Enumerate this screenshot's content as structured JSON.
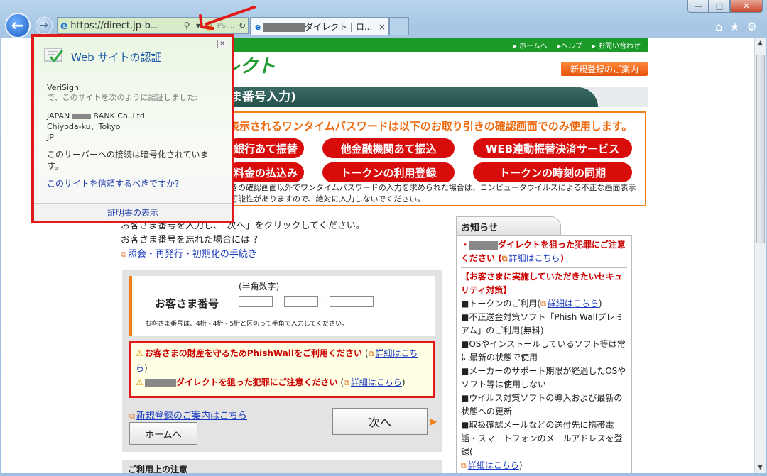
{
  "window": {
    "minimize": "—",
    "maximize": "□",
    "close": "✕"
  },
  "nav": {
    "back_icon": "←",
    "forward_icon": "→"
  },
  "address_bar": {
    "url": "https://direct.jp-b...",
    "search_icon": "⚲",
    "lock_icon": "🔒",
    "refresh_icon": "↻",
    "tint": "#d7ebc9"
  },
  "tabs": [
    {
      "title": "ダイレクト | ロ...",
      "close": "×"
    }
  ],
  "toolbar": {
    "home_icon": "⌂",
    "favorites_icon": "★",
    "settings_icon": "⚙"
  },
  "page": {
    "top_links": [
      "▸ ホームへ",
      "▸ヘルプ",
      "▸ お問い合わせ"
    ],
    "logo_text": "レクト",
    "register_button": "新規登録のご案内",
    "heading": "ま番号入力)",
    "otp": {
      "title": "表示されるワンタイムパスワードは以下のお取り引きの確認画面でのみ使用します。",
      "pills": [
        "銀行あて振替",
        "他金融機関あて振込",
        "WEB連動振替決済サービス",
        "料金の払込み",
        "トークンの利用登録",
        "トークンの時刻の同期"
      ],
      "note1": "きの確認画面以外でワンタイムパスワードの入力を求められた場合は、コンピュータウイルスによる不正な画面表示",
      "note2": "可能性がありますので、絶対に入力しないでください。"
    },
    "instructions": {
      "line1": "お客さま番号を入力し、「次へ」をクリックしてください。",
      "line2": "お客さま番号を忘れた場合には ?",
      "link": "照会・再発行・初期化の手続き"
    },
    "form": {
      "hint": "(半角数字)",
      "label": "お客さま番号",
      "dash": "-",
      "small_note": "お客さま番号は、4桁 - 4桁 - 5桁と区切って半角で入力してください。"
    },
    "warnings": {
      "w1": "お客さまの財産を守るためPhishWallをご利用ください",
      "w1_link": "詳細はこちら",
      "w2": "ダイレクトを狙った犯罪にご注意ください",
      "w2_link": "詳細はこちら"
    },
    "new_reg_link": "新規登録のご案内はこちら",
    "home_button": "ホームへ",
    "next_button": "次へ",
    "bottom_notice": "ご利用上の注意"
  },
  "news": {
    "tab": "お知らせ",
    "item1": "ダイレクトを狙った犯罪にご注意ください",
    "item1_link": "詳細はこちら",
    "section_title": "【お客さまに実施していただきたいセキュリティ対策】",
    "items": [
      "■トークンのご利用(",
      "■不正送金対策ソフト「Phish Wallプレミアム」のご利用(無料)",
      "■OSやインストールしているソフト等は常に最新の状態で使用",
      "■メーカーのサポート期限が経過したOSやソフト等は使用しない",
      "■ウイルス対策ソフトの導入および最新の状態への更新",
      "■取扱確認メールなどの送付先に携帯電話・スマートフォンのメールアドレスを登録("
    ],
    "link": "詳細はこちら"
  },
  "popup": {
    "title": "Web サイトの認証",
    "issuer": "VeriSign",
    "issuer_desc": "で、このサイトを次のように認証しました:",
    "org_line1_a": "JAPAN",
    "org_line1_b": "BANK Co.,Ltd.",
    "org_line2": "Chiyoda-ku、Tokyo",
    "org_line3": "JP",
    "encrypted": "このサーバーへの接続は暗号化されています。",
    "trust_link": "このサイトを信頼するべきですか?",
    "view_cert": "証明書の表示",
    "close": "✕"
  }
}
